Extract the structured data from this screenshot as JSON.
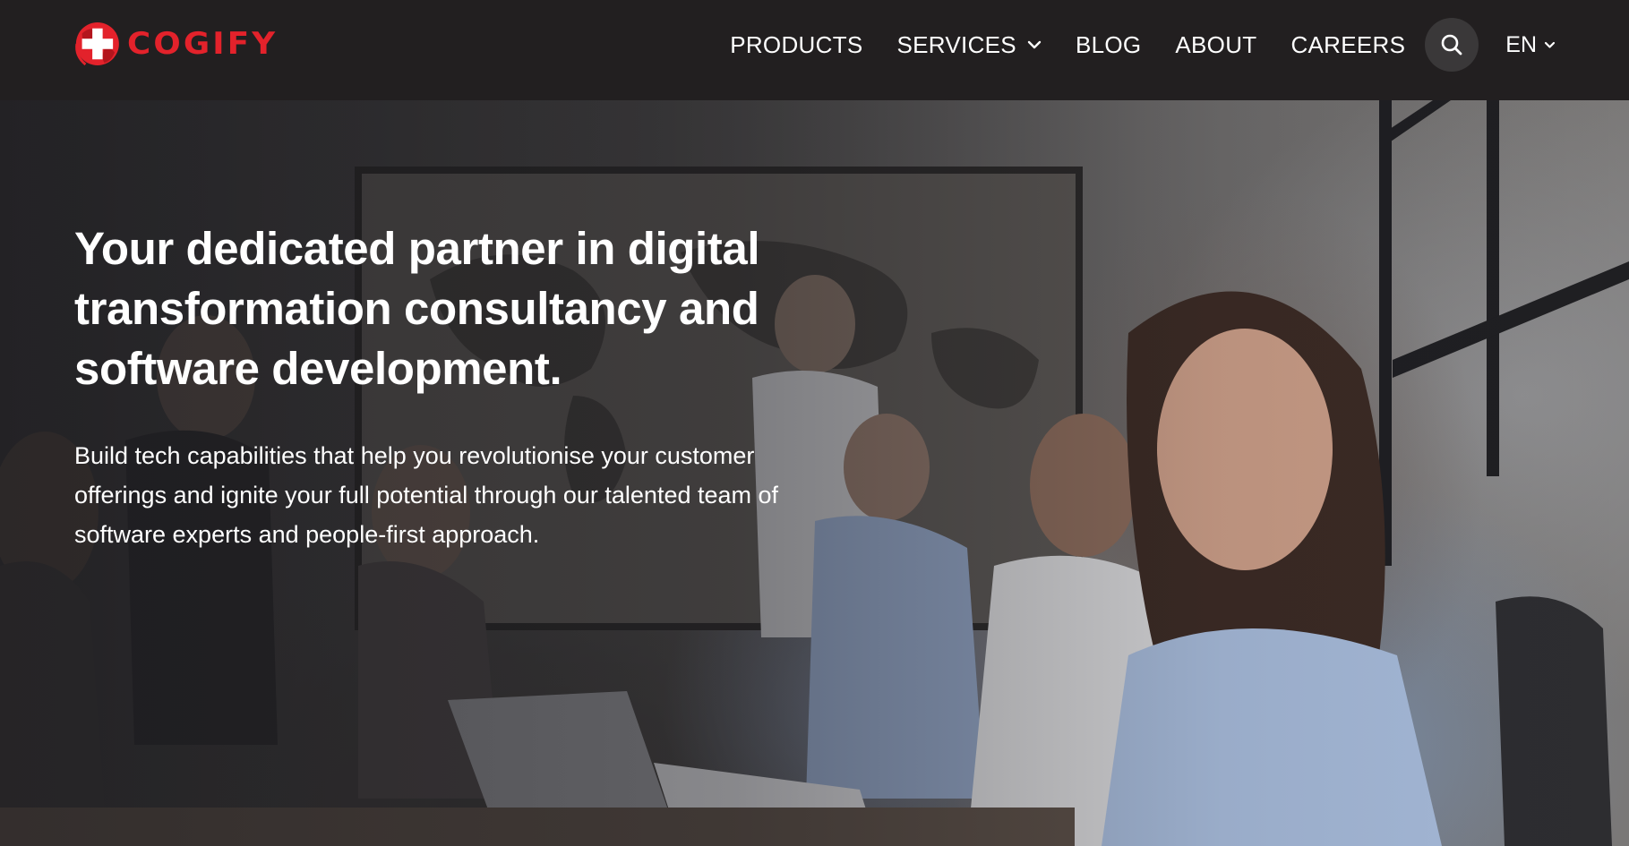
{
  "brand": {
    "name": "COGIFY",
    "accent_color": "#e3222b",
    "logo_icon": "globe-cross-icon"
  },
  "nav": {
    "items": [
      {
        "label": "PRODUCTS",
        "has_dropdown": false
      },
      {
        "label": "SERVICES",
        "has_dropdown": true
      },
      {
        "label": "BLOG",
        "has_dropdown": false
      },
      {
        "label": "ABOUT",
        "has_dropdown": false
      },
      {
        "label": "CAREERS",
        "has_dropdown": false
      }
    ],
    "search_icon": "search-icon",
    "language": "EN"
  },
  "hero": {
    "title": "Your dedicated partner in digital transformation consultancy and software development.",
    "subtitle": "Build tech capabilities that help you revolutionise your customer offerings and ignite your full potential through our talented team of software experts and people-first approach."
  },
  "colors": {
    "nav_background": "#221f20",
    "search_button_background": "#3a3839",
    "text": "#ffffff"
  }
}
